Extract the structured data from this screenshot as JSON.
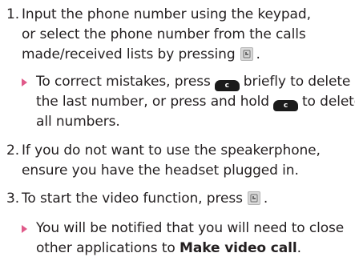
{
  "steps": [
    {
      "number": "1.",
      "lines": [
        "Input the phone number using the keypad,",
        "or select the phone number from the calls",
        "made/received lists by pressing"
      ],
      "line3_end": "."
    },
    {
      "number": "2.",
      "lines": [
        "If you do not want to use the speakerphone,",
        "ensure you have the headset plugged in."
      ]
    },
    {
      "number": "3.",
      "lines": [
        "To start the video function, press"
      ],
      "line1_end": "."
    }
  ],
  "bullets": [
    {
      "l1_a": "To correct mistakes, press",
      "l1_b": "briefly to delete",
      "l2_a": "the last number, or press and hold",
      "l2_b": "to delete",
      "l3": "all numbers."
    },
    {
      "l1": "You will be notified that you will need to close",
      "l2_a": "other applications to",
      "l2_bold": "Make video call",
      "l2_end": "."
    }
  ],
  "keys": {
    "clear_key_label": "c",
    "icon_phone_key": "video-call-key-icon",
    "icon_clear_key": "clear-key-icon"
  },
  "colors": {
    "text": "#231f20",
    "bullet_arrow": "#e05a8a",
    "clear_key": "#1a1a1a"
  }
}
